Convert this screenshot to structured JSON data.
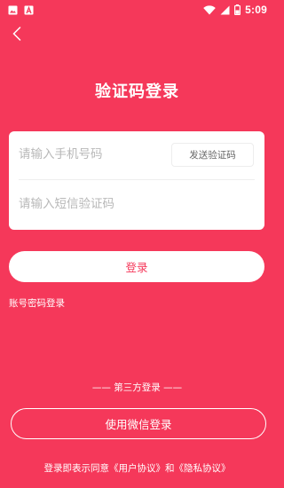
{
  "status_bar": {
    "time": "5:09",
    "icons": [
      "image-icon",
      "text-a-icon",
      "wifi-icon",
      "signal-icon",
      "battery-icon"
    ]
  },
  "header": {
    "back_icon": "chevron-left-icon",
    "title": "验证码登录"
  },
  "form": {
    "phone_placeholder": "请输入手机号码",
    "code_placeholder": "请输入短信验证码",
    "send_code_label": "发送验证码"
  },
  "actions": {
    "login_label": "登录",
    "account_login_label": "账号密码登录"
  },
  "third_party": {
    "section_label": "—— 第三方登录 ——",
    "wechat_label": "使用微信登录"
  },
  "footer": {
    "agreement_text": "登录即表示同意《用户协议》和《隐私协议》"
  },
  "colors": {
    "background": "#F5385A",
    "card": "#FFFFFF",
    "accent_text": "#F5385A"
  }
}
